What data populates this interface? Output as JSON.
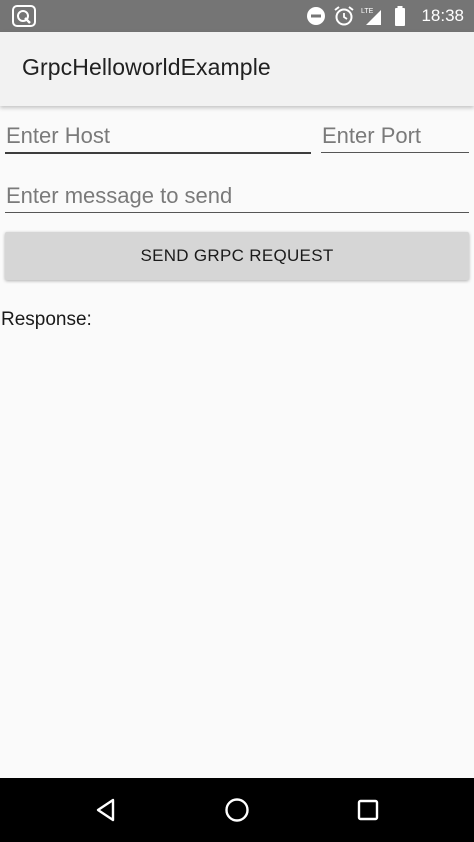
{
  "status_bar": {
    "left_icon": "app-notification-icon",
    "icons": [
      "do-not-disturb-icon",
      "alarm-icon",
      "lte-signal-icon",
      "battery-icon"
    ],
    "network_label": "LTE",
    "time": "18:38"
  },
  "app_bar": {
    "title": "GrpcHelloworldExample"
  },
  "form": {
    "host": {
      "value": "",
      "placeholder": "Enter Host"
    },
    "port": {
      "value": "",
      "placeholder": "Enter Port"
    },
    "message": {
      "value": "",
      "placeholder": "Enter message to send"
    },
    "send_label": "SEND GRPC REQUEST"
  },
  "response": {
    "label": "Response:"
  },
  "nav_bar": {
    "icons": [
      "back-icon",
      "home-icon",
      "recents-icon"
    ]
  },
  "colors": {
    "status_bar": "#757575",
    "app_bar": "#f2f2f2",
    "background": "#fafafa",
    "button": "#d6d6d6",
    "nav_bar": "#000000"
  }
}
